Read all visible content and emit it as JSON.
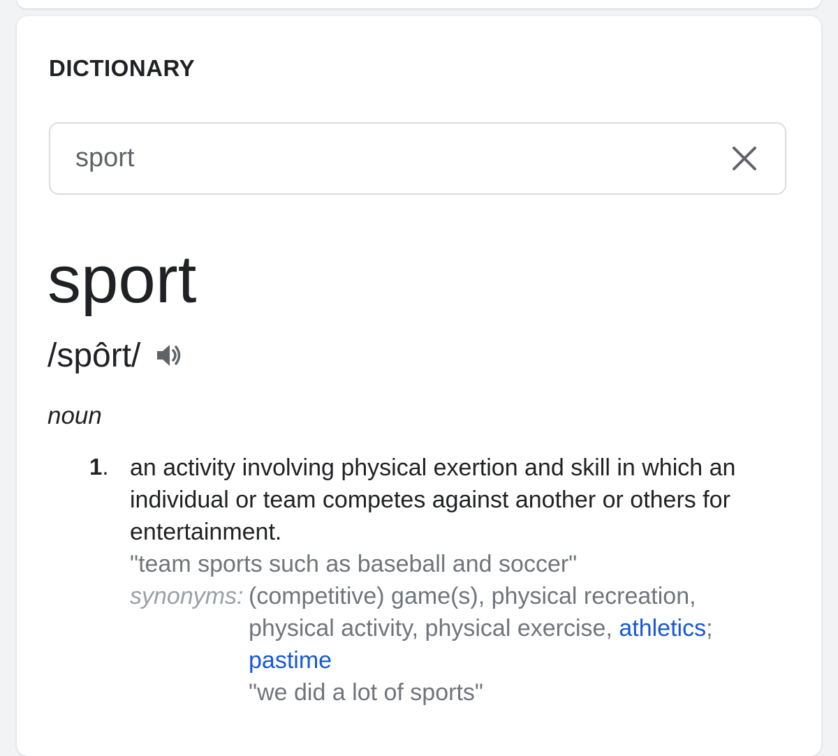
{
  "dictionary": {
    "section_title": "DICTIONARY",
    "search": {
      "value": "sport",
      "clear_icon": "close-icon"
    },
    "entry": {
      "word": "sport",
      "phonetic": "/spôrt/",
      "speaker_icon": "speaker-icon",
      "part_of_speech": "noun",
      "definitions": [
        {
          "number": "1",
          "text": "an activity involving physical exertion and skill in which an individual or team competes against another or others for entertainment.",
          "example": "\"team sports such as baseball and soccer\"",
          "synonyms_label": "synonyms:",
          "synonyms_text_1": "(competitive) game(s), physical recreation, physical activity, physical exercise, ",
          "synonym_link_1": "athletics",
          "synonyms_sep": ";",
          "synonym_link_2": "pastime",
          "example_2": "\"we did a lot of sports\""
        }
      ]
    }
  },
  "colors": {
    "text": "#202124",
    "muted": "#70757a",
    "link": "#1558d6",
    "border": "#dadce0"
  }
}
